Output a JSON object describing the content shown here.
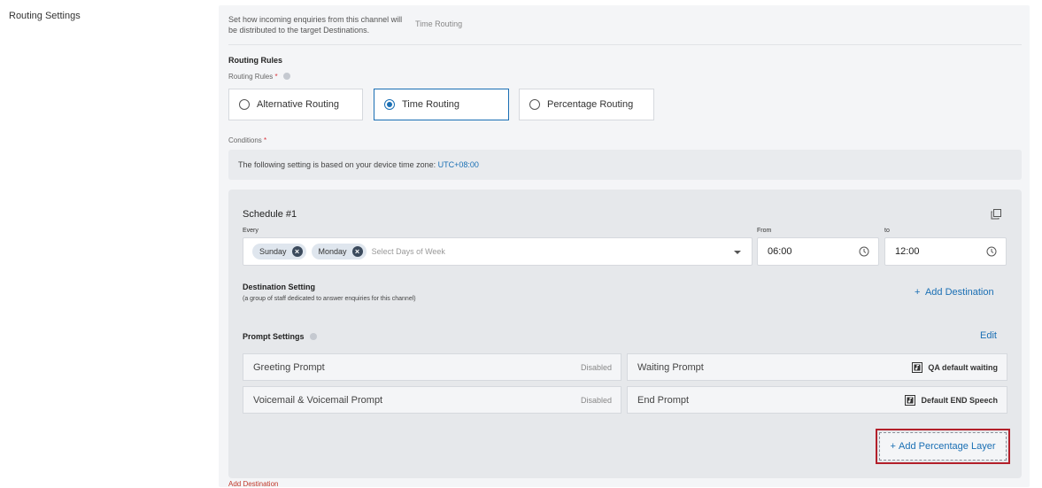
{
  "sidebar": {
    "title": "Routing Settings"
  },
  "intro": {
    "description": "Set how incoming enquiries from this channel will be distributed to the target Destinations.",
    "current_mode": "Time Routing"
  },
  "routing_rules": {
    "section_title": "Routing Rules",
    "field_label": "Routing Rules",
    "required_mark": "*",
    "options": [
      {
        "label": "Alternative Routing",
        "selected": false
      },
      {
        "label": "Time Routing",
        "selected": true
      },
      {
        "label": "Percentage Routing",
        "selected": false
      }
    ]
  },
  "conditions": {
    "label": "Conditions",
    "required_mark": "*",
    "notice_text": "The following setting is based on your device time zone:",
    "timezone": "UTC+08:00"
  },
  "schedule": {
    "title": "Schedule #1",
    "every_label": "Every",
    "days": [
      "Sunday",
      "Monday"
    ],
    "days_placeholder": "Select Days of Week",
    "from_label": "From",
    "from_value": "06:00",
    "to_label": "to",
    "to_value": "12:00"
  },
  "destination": {
    "title": "Destination Setting",
    "subtitle": "(a group of staff dedicated to answer enquiries for this channel)",
    "add_label": "Add Destination"
  },
  "prompts": {
    "title": "Prompt Settings",
    "edit_label": "Edit",
    "items": [
      {
        "label": "Greeting Prompt",
        "status": "Disabled"
      },
      {
        "label": "Waiting Prompt",
        "status": "QA default waiting"
      },
      {
        "label": "Voicemail & Voicemail Prompt",
        "status": "Disabled"
      },
      {
        "label": "End Prompt",
        "status": "Default END Speech"
      }
    ]
  },
  "actions": {
    "add_percentage_layer": "Add Percentage Layer",
    "footer_link": "Add Destination"
  },
  "colors": {
    "accent": "#1a6fb4",
    "highlight": "#b3202a",
    "required": "#d9363e"
  }
}
